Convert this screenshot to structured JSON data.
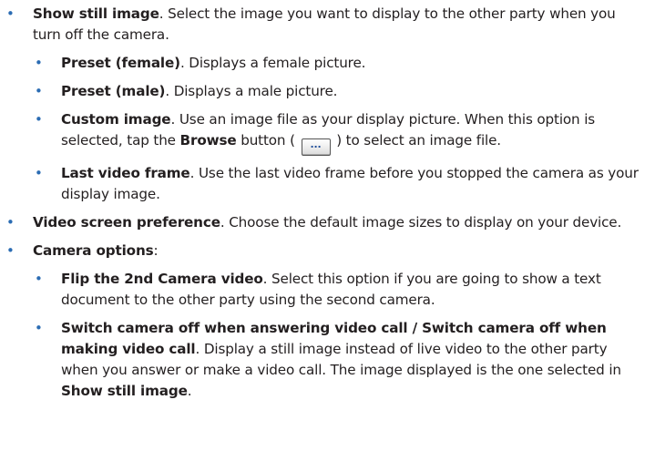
{
  "bullet_glyph": "•",
  "items": [
    {
      "level": 1,
      "term": "Show still image",
      "sep": ".",
      "desc": " Select the image you want to display to the other party when you turn off the camera."
    },
    {
      "level": 2,
      "term": "Preset (female)",
      "sep": ".",
      "desc": " Displays a female picture."
    },
    {
      "level": 2,
      "term": "Preset (male)",
      "sep": ".",
      "desc": " Displays a male picture."
    },
    {
      "level": 2,
      "term": "Custom image",
      "sep": ".",
      "desc_a": " Use an image file as your display picture. When this option is selected, tap the ",
      "inline_term": "Browse",
      "desc_b": " button ( ",
      "button_label": "...",
      "desc_c": " ) to select an image file."
    },
    {
      "level": 2,
      "term": "Last video frame",
      "sep": ".",
      "desc": " Use the last video frame before you stopped the camera as your display image."
    },
    {
      "level": 1,
      "term": "Video screen preference",
      "sep": ".",
      "desc": " Choose the default image sizes to display on your device."
    },
    {
      "level": 1,
      "term": "Camera options",
      "sep": ":",
      "desc": ""
    },
    {
      "level": 2,
      "term": "Flip the 2nd Camera video",
      "sep": ".",
      "desc": " Select this option if you are going to show a text document to the other party using the second camera."
    },
    {
      "level": 2,
      "term": "Switch camera off when answering video call / Switch camera off when making video call",
      "sep": ".",
      "desc_a": " Display a still image instead of live video to the other party when you answer or make a video call. The image displayed is the one selected in ",
      "inline_term": "Show still image",
      "desc_b": "."
    }
  ]
}
